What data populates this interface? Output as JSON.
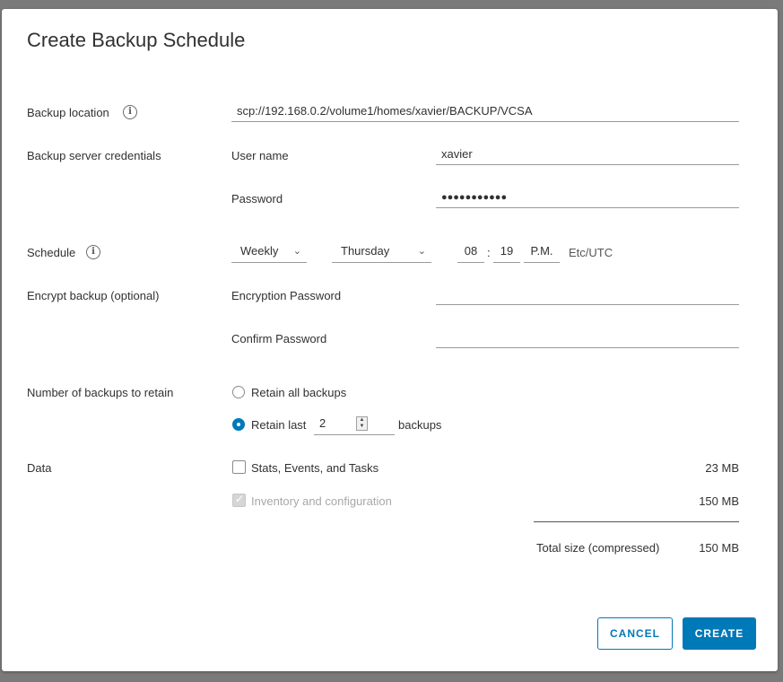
{
  "dialog": {
    "title": "Create Backup Schedule"
  },
  "backup_location": {
    "label": "Backup location",
    "value": "scp://192.168.0.2/volume1/homes/xavier/BACKUP/VCSA"
  },
  "credentials": {
    "label": "Backup server credentials",
    "username_label": "User name",
    "username_value": "xavier",
    "password_label": "Password",
    "password_value": "●●●●●●●●●●●"
  },
  "schedule": {
    "label": "Schedule",
    "frequency": "Weekly",
    "day": "Thursday",
    "hour": "08",
    "minute": "19",
    "separator": ":",
    "ampm": "P.M.",
    "timezone": "Etc/UTC"
  },
  "encrypt": {
    "label": "Encrypt backup (optional)",
    "password_label": "Encryption Password",
    "password_value": "",
    "confirm_label": "Confirm Password",
    "confirm_value": ""
  },
  "retention": {
    "label": "Number of backups to retain",
    "retain_all_label": "Retain all backups",
    "retain_all_selected": false,
    "retain_last_label": "Retain last",
    "retain_last_selected": true,
    "retain_last_value": "2",
    "retain_last_suffix": "backups"
  },
  "data": {
    "label": "Data",
    "items": [
      {
        "label": "Stats, Events, and Tasks",
        "size": "23 MB",
        "checked": false,
        "disabled": false
      },
      {
        "label": "Inventory and configuration",
        "size": "150 MB",
        "checked": true,
        "disabled": true
      }
    ],
    "total_label": "Total size (compressed)",
    "total_value": "150 MB"
  },
  "footer": {
    "cancel_label": "CANCEL",
    "create_label": "CREATE"
  },
  "colors": {
    "accent": "#0079b8",
    "overlay": "#7a7a7a"
  },
  "icons": {
    "info": "info-icon",
    "chevron": "chevron-down-icon",
    "check": "check-icon"
  }
}
